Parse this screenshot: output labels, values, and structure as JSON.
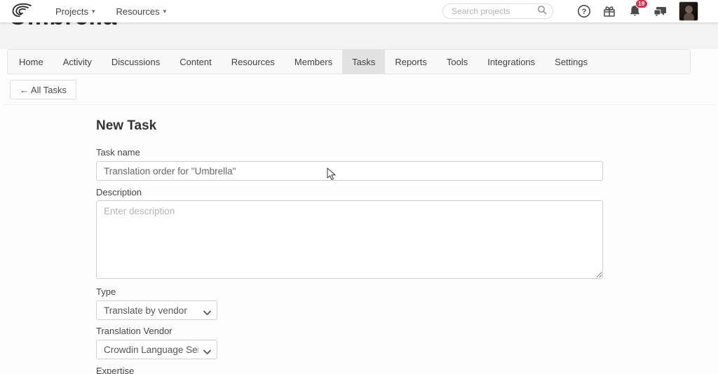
{
  "header": {
    "logo_name": "crowdin-swirl-logo",
    "nav": {
      "projects": "Projects",
      "resources": "Resources"
    },
    "search": {
      "placeholder": "Search projects"
    },
    "notifications": {
      "badge_count": "19"
    }
  },
  "project": {
    "title": "Umbrella"
  },
  "tabs": {
    "items": [
      {
        "label": "Home"
      },
      {
        "label": "Activity"
      },
      {
        "label": "Discussions"
      },
      {
        "label": "Content"
      },
      {
        "label": "Resources"
      },
      {
        "label": "Members"
      },
      {
        "label": "Tasks"
      },
      {
        "label": "Reports"
      },
      {
        "label": "Tools"
      },
      {
        "label": "Integrations"
      },
      {
        "label": "Settings"
      }
    ],
    "active": "Tasks"
  },
  "toolbar": {
    "back_label": "← All Tasks"
  },
  "form": {
    "title": "New Task",
    "task_name": {
      "label": "Task name",
      "value": "Translation order for \"Umbrella\""
    },
    "description": {
      "label": "Description",
      "placeholder": "Enter description"
    },
    "type": {
      "label": "Type",
      "value": "Translate by vendor"
    },
    "vendor": {
      "label": "Translation Vendor",
      "value": "Crowdin Language Service"
    },
    "expertise": {
      "label": "Expertise"
    }
  },
  "colors": {
    "badge_red": "#d92b4b",
    "active_tab_bg": "#e2e2e2",
    "tabbar_bg": "#f8f8f8",
    "band_bg": "#f3f3f3",
    "input_border": "#cfcfcf"
  }
}
